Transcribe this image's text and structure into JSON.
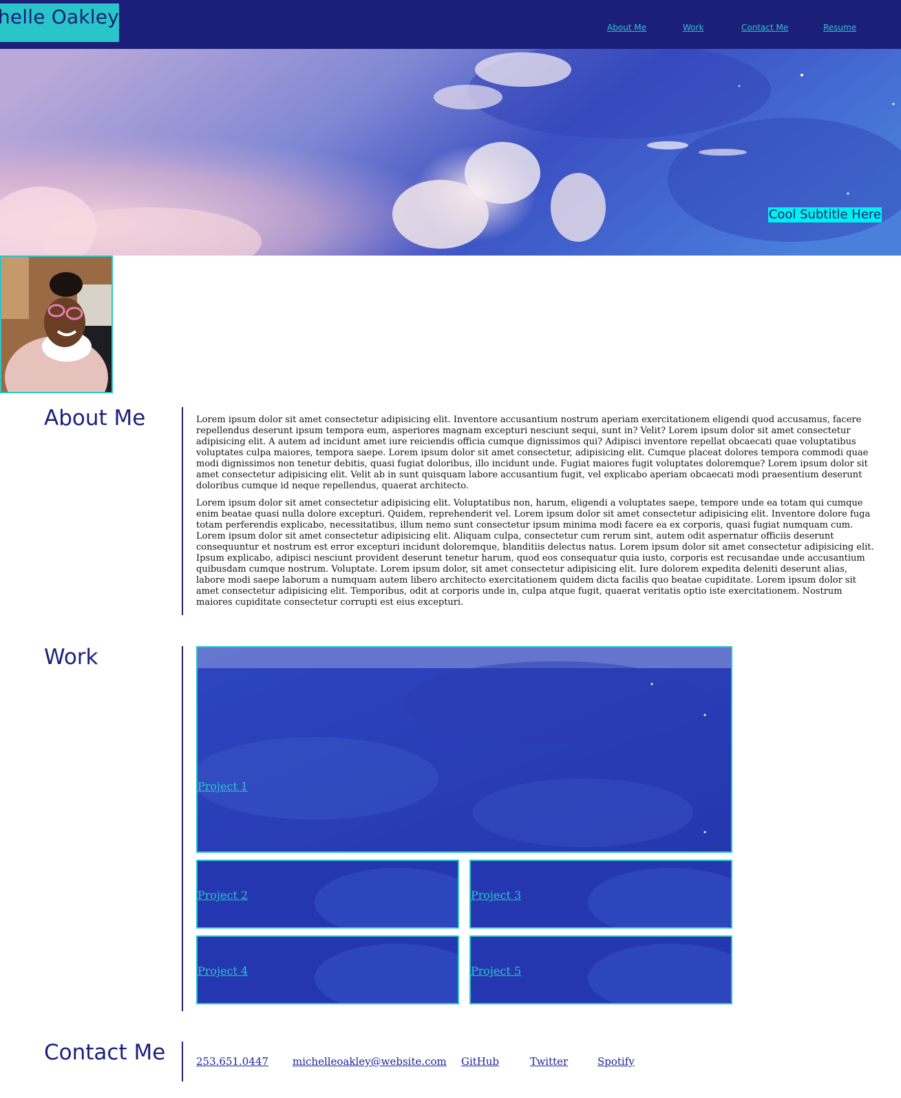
{
  "header": {
    "brand": "chelle Oakley",
    "nav": [
      {
        "label": "About Me"
      },
      {
        "label": "Work"
      },
      {
        "label": "Contact Me"
      },
      {
        "label": "Resume"
      }
    ]
  },
  "hero": {
    "subtitle": "Cool Subtitle Here"
  },
  "about": {
    "title": "About Me",
    "paragraphs": [
      "Lorem ipsum dolor sit amet consectetur adipisicing elit. Inventore accusantium nostrum aperiam exercitationem eligendi quod accusamus, facere repellendus deserunt ipsum tempora eum, asperiores magnam excepturi nesciunt sequi, sunt in? Velit? Lorem ipsum dolor sit amet consectetur adipisicing elit. A autem ad incidunt amet iure reiciendis officia cumque dignissimos qui? Adipisci inventore repellat obcaecati quae voluptatibus voluptates culpa maiores, tempora saepe. Lorem ipsum dolor sit amet consectetur, adipisicing elit. Cumque placeat dolores tempora commodi quae modi dignissimos non tenetur debitis, quasi fugiat doloribus, illo incidunt unde. Fugiat maiores fugit voluptates doloremque? Lorem ipsum dolor sit amet consectetur adipisicing elit. Velit ab in sunt quisquam labore accusantium fugit, vel explicabo aperiam obcaecati modi praesentium deserunt doloribus cumque id neque repellendus, quaerat architecto.",
      "Lorem ipsum dolor sit amet consectetur adipisicing elit. Voluptatibus non, harum, eligendi a voluptates saepe, tempore unde ea totam qui cumque enim beatae quasi nulla dolore excepturi. Quidem, reprehenderit vel. Lorem ipsum dolor sit amet consectetur adipisicing elit. Inventore dolore fuga totam perferendis explicabo, necessitatibus, illum nemo sunt consectetur ipsum minima modi facere ea ex corporis, quasi fugiat numquam cum. Lorem ipsum dolor sit amet consectetur adipisicing elit. Aliquam culpa, consectetur cum rerum sint, autem odit aspernatur officiis deserunt consequuntur et nostrum est error excepturi incidunt doloremque, blanditiis delectus natus. Lorem ipsum dolor sit amet consectetur adipisicing elit. Ipsum explicabo, adipisci nesciunt provident deserunt tenetur harum, quod eos consequatur quia iusto, corporis est recusandae unde accusantium quibusdam cumque nostrum. Voluptate. Lorem ipsum dolor, sit amet consectetur adipisicing elit. Iure dolorem expedita deleniti deserunt alias, labore modi saepe laborum a numquam autem libero architecto exercitationem quidem dicta facilis quo beatae cupiditate. Lorem ipsum dolor sit amet consectetur adipisicing elit. Temporibus, odit at corporis unde in, culpa atque fugit, quaerat veritatis optio iste exercitationem. Nostrum maiores cupiditate consectetur corrupti est eius excepturi."
    ]
  },
  "work": {
    "title": "Work",
    "projects": [
      {
        "label": "Project 1"
      },
      {
        "label": "Project 2"
      },
      {
        "label": "Project 3"
      },
      {
        "label": "Project 4"
      },
      {
        "label": "Project 5"
      }
    ]
  },
  "contact": {
    "title": "Contact Me",
    "links": [
      {
        "label": "253.651.0447"
      },
      {
        "label": "michelleoakley@website.com"
      },
      {
        "label": "GitHub"
      },
      {
        "label": "Twitter"
      },
      {
        "label": "Spotify"
      }
    ]
  },
  "colors": {
    "navy": "#1c1f7a",
    "teal": "#29c5c9",
    "cyan_highlight": "#00f0f0",
    "tile_blue": "#2537b0"
  }
}
